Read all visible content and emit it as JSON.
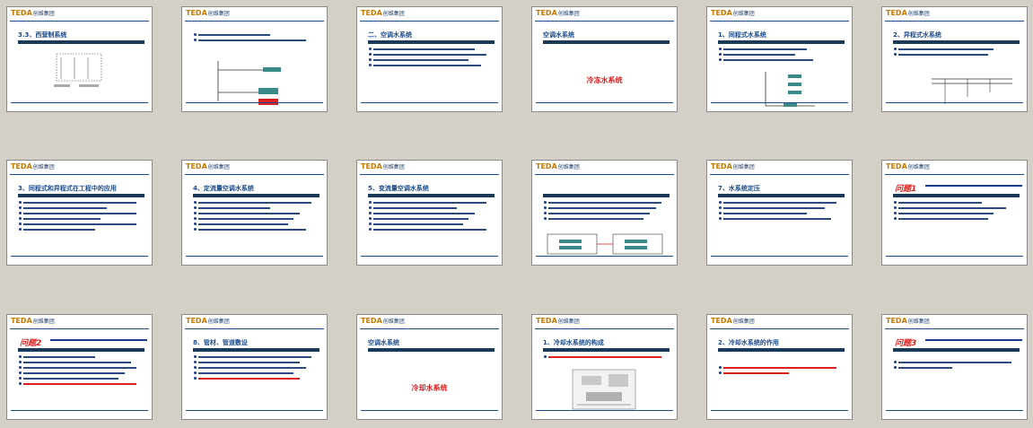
{
  "slides": [
    {
      "title": "3.3、西营制系统"
    },
    {
      "title": ""
    },
    {
      "title": "二、空调水系统"
    },
    {
      "title": "空调水系统",
      "center": "冷冻水系统"
    },
    {
      "title": "1、同程式水系统"
    },
    {
      "title": "2、异程式水系统"
    },
    {
      "title": "3、同程式和异程式在工程中的应用"
    },
    {
      "title": "4、定流量空调水系统"
    },
    {
      "title": "5、变流量空调水系统"
    },
    {
      "title": ""
    },
    {
      "title": "7、水系统定压"
    },
    {
      "title": "问题1"
    },
    {
      "title": "问题2"
    },
    {
      "title": "8、管材、管道敷设"
    },
    {
      "title": "空调水系统",
      "center": "冷却水系统"
    },
    {
      "title": "1、冷却水系统的构成"
    },
    {
      "title": "2、冷却水系统的作用"
    },
    {
      "title": "问题3"
    }
  ],
  "logo": {
    "mark": "TEDA",
    "sub": "创维集团"
  },
  "colors": {
    "accent": "#1a4a8a",
    "red": "#e02020"
  }
}
